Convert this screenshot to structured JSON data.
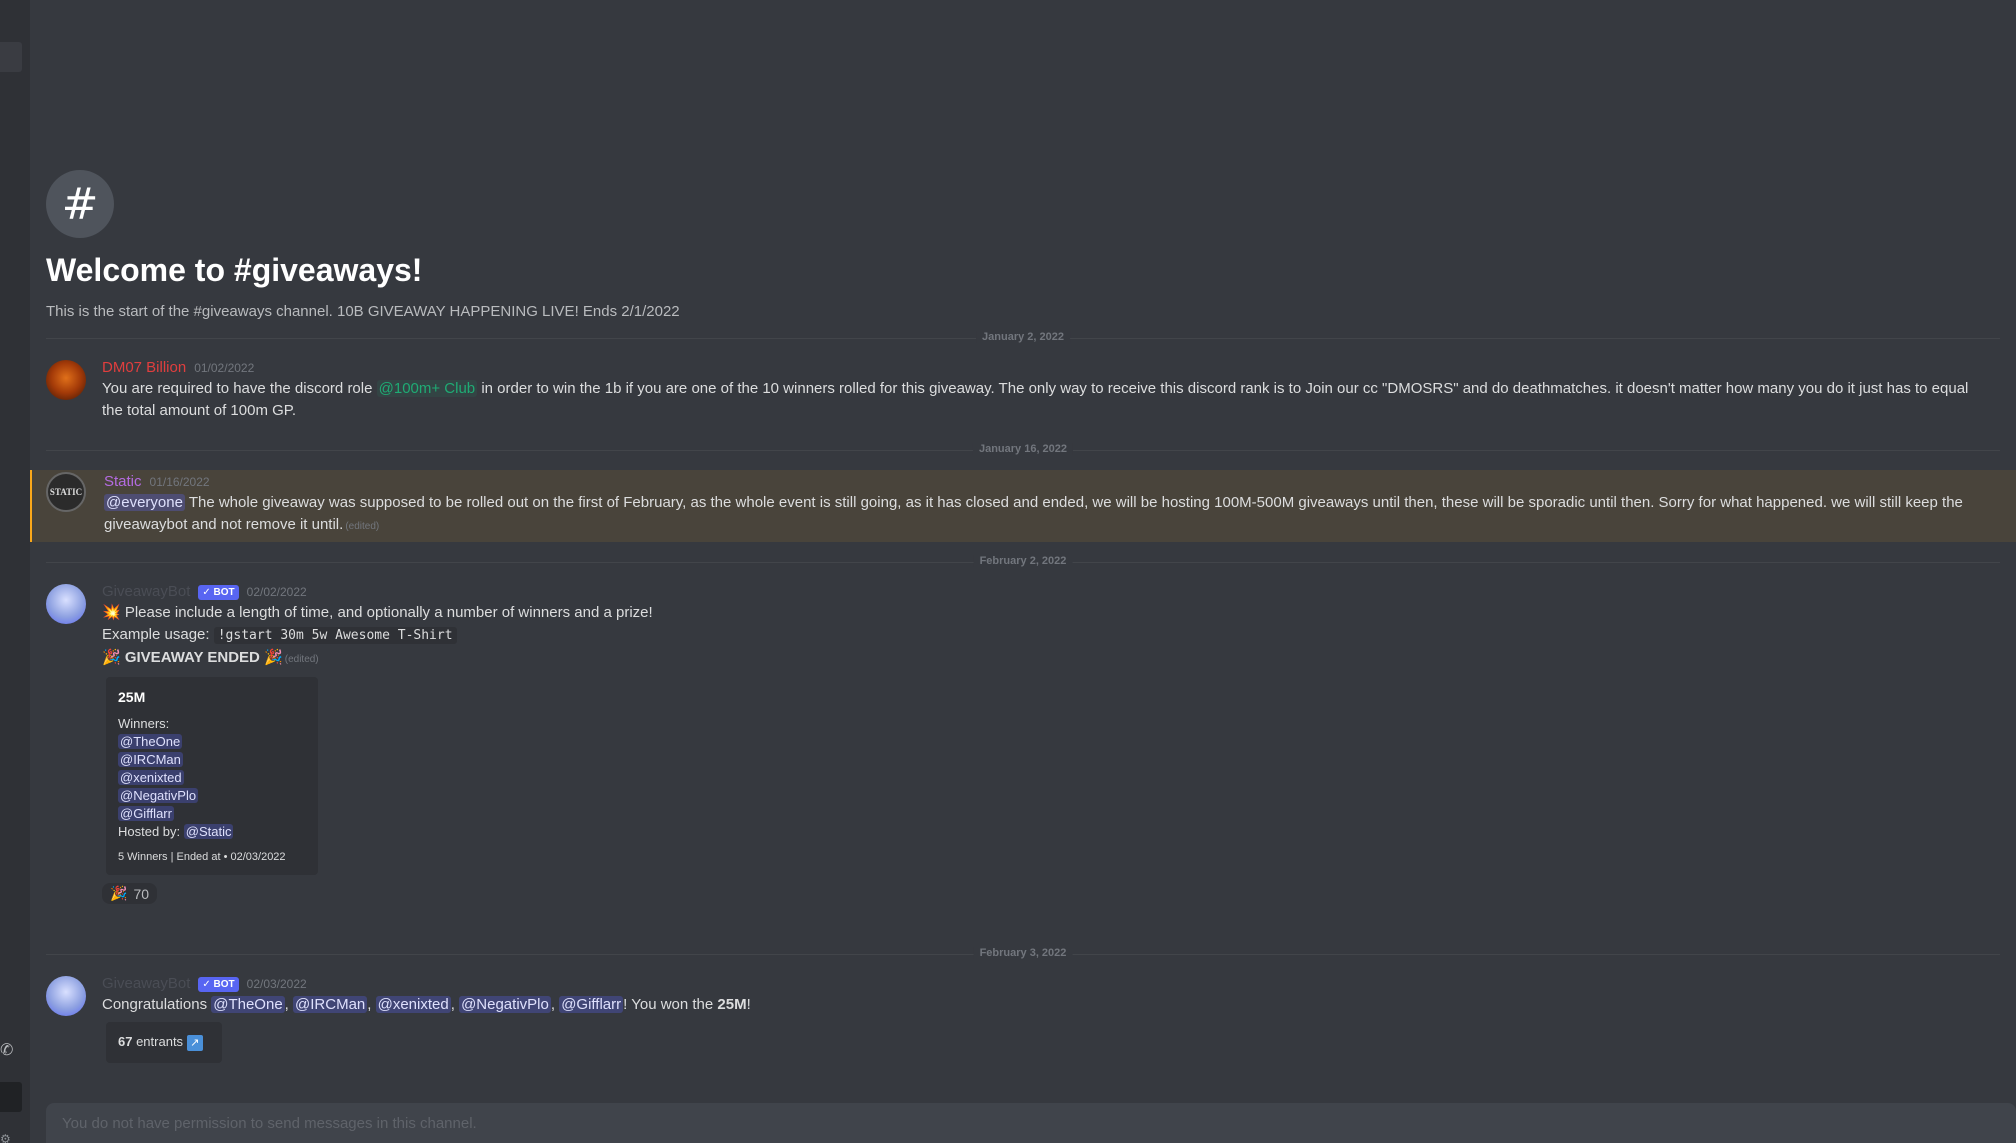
{
  "channel": {
    "hash": "#",
    "welcome_title": "Welcome to #giveaways!",
    "welcome_desc": "This is the start of the #giveaways channel. 10B GIVEAWAY HAPPENING LIVE! Ends 2/1/2022"
  },
  "dividers": [
    "January 2, 2022",
    "January 16, 2022",
    "February 2, 2022",
    "February 3, 2022"
  ],
  "messages": [
    {
      "username": "DM07 Billion",
      "timestamp": "01/02/2022",
      "text_before": "You are required to have the discord role ",
      "role": "@100m+ Club",
      "text_after": "  in order to win the 1b if you are one of the 10 winners rolled for this giveaway. The only way to receive this discord rank is to Join our cc \"DMOSRS\" and do deathmatches. it doesn't matter how many you do it just has to equal the total amount of 100m GP."
    },
    {
      "username": "Static",
      "avatar_text": "STATIC",
      "timestamp": "01/16/2022",
      "mention": "@everyone",
      "text": " The whole giveaway was supposed to be rolled out on the first of February, as the whole event is still going, as it has closed and ended, we will be hosting 100M-500M giveaways until then, these will be sporadic until then. Sorry for what happened. we will still keep the giveawaybot and not remove it until.",
      "edited": "(edited)"
    },
    {
      "username": "GiveawayBot",
      "bot_tag": "✓ BOT",
      "timestamp": "02/02/2022",
      "line1": "💥 Please include a length of time, and optionally a number of winners and a prize!",
      "line2_prefix": "Example usage: ",
      "line2_code": "!gstart 30m 5w Awesome T-Shirt",
      "ended_text": "🎉 GIVEAWAY ENDED 🎉",
      "edited": "(edited)",
      "embed": {
        "title": "25M",
        "winners_label": "Winners:",
        "winners": [
          "@TheOne",
          "@IRCMan",
          "@xenixted",
          "@NegativPlo",
          "@Gifflarr"
        ],
        "hosted_label": "Hosted by: ",
        "host": "@Static",
        "footer": "5 Winners | Ended at • 02/03/2022"
      },
      "reaction": {
        "emoji": "🎉",
        "count": "70"
      }
    },
    {
      "username": "GiveawayBot",
      "bot_tag": "✓ BOT",
      "timestamp": "02/03/2022",
      "congrats": "Congratulations ",
      "winners": [
        "@TheOne",
        "@IRCMan",
        "@xenixted",
        "@NegativPlo",
        "@Gifflarr"
      ],
      "won_text": "! You won the ",
      "prize": "25M",
      "excl": "!",
      "entrants_count": "67",
      "entrants_label": " entrants ",
      "entrants_icon": "↗"
    }
  ],
  "composer": {
    "placeholder": "You do not have permission to send messages in this channel."
  },
  "colors": {
    "background": "#36393f",
    "mention": "#5865f2",
    "highlight_border": "#faa81a",
    "role": "#1fab74",
    "dm07": "#e03e3e",
    "static": "#b36be0"
  }
}
